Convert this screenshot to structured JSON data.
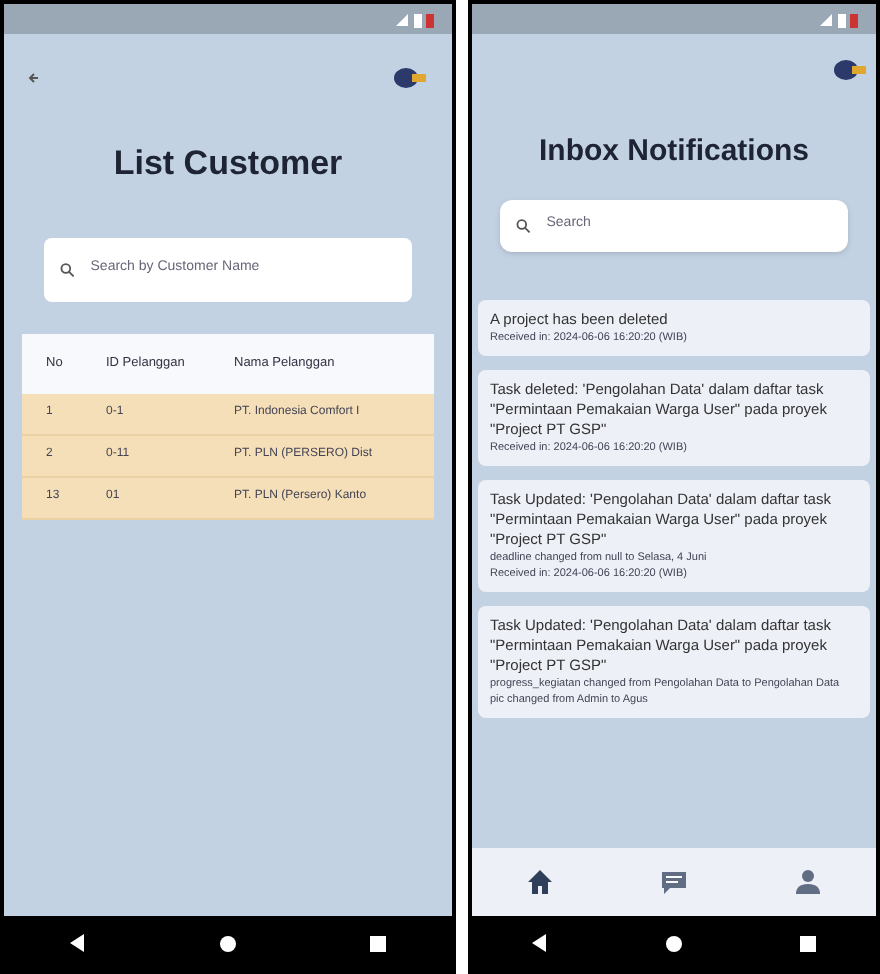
{
  "customer_screen": {
    "title": "List Customer",
    "search": {
      "placeholder": "Search by Customer Name"
    },
    "table": {
      "columns": [
        "No",
        "ID Pelanggan",
        "Nama Pelanggan"
      ],
      "rows": [
        [
          "1",
          "0-1",
          "PT. Indonesia Comfort I"
        ],
        [
          "2",
          "0-11",
          "PT. PLN (PERSERO) Dist"
        ],
        [
          "13",
          "01",
          "PT. PLN (Persero) Kanto"
        ]
      ]
    }
  },
  "inbox_screen": {
    "title": "Inbox Notifications",
    "search": {
      "placeholder": "Search"
    },
    "notifications": [
      {
        "message": "A project has been deleted",
        "received": "Received in: 2024-06-06 16:20:20 (WIB)"
      },
      {
        "message": "Task deleted: 'Pengolahan Data' dalam daftar task \"Permintaan Pemakaian Warga User\" pada proyek \"Project PT GSP\"",
        "received": "Received in: 2024-06-06 16:20:20 (WIB)"
      },
      {
        "message": "Task Updated: 'Pengolahan Data' dalam daftar task \"Permintaan Pemakaian Warga User\" pada proyek \"Project PT GSP\"",
        "details": [
          "deadline changed from null to Selasa, 4 Juni"
        ],
        "received": "Received in: 2024-06-06 16:20:20 (WIB)"
      },
      {
        "message": "Task Updated: 'Pengolahan Data' dalam daftar task \"Permintaan Pemakaian Warga User\" pada proyek \"Project PT GSP\"",
        "details": [
          "progress_kegiatan changed from Pengolahan Data to Pengolahan Data",
          "pic changed from Admin to Agus"
        ]
      }
    ],
    "bottom_nav": [
      {
        "kind": "home",
        "selected": true
      },
      {
        "kind": "chat",
        "selected": false
      },
      {
        "kind": "person",
        "selected": false
      }
    ]
  }
}
